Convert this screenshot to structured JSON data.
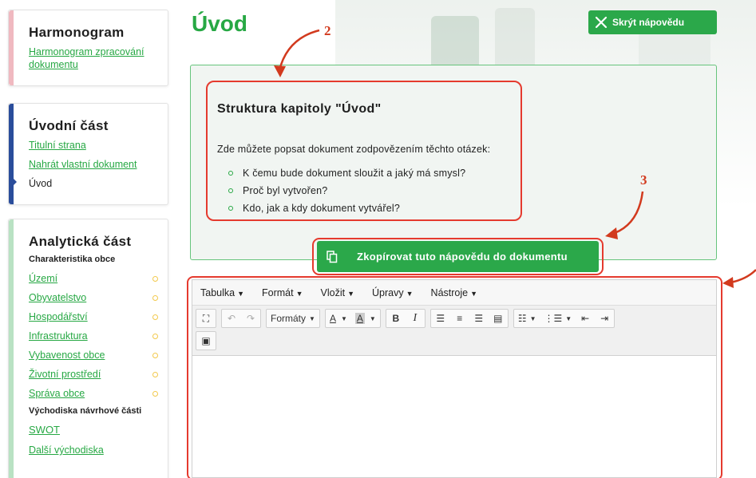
{
  "sidebar": {
    "harmonogram": {
      "title": "Harmonogram",
      "links": [
        "Harmonogram zpracování dokumentu"
      ]
    },
    "uvodni": {
      "title": "Úvodní část",
      "links": [
        "Titulní strana",
        "Nahrát vlastní dokument"
      ],
      "current": "Úvod"
    },
    "analyticka": {
      "title": "Analytická část",
      "section1": "Charakteristika obce",
      "items": [
        "Území",
        "Obyvatelstvo",
        "Hospodářství",
        "Infrastruktura",
        "Vybavenost obce",
        "Životní prostředí",
        "Správa obce"
      ],
      "section2": "Východiska návrhové části",
      "items2": [
        "SWOT",
        "Další východiska"
      ]
    }
  },
  "main": {
    "title": "Úvod",
    "hide_help": "Skrýt nápovědu",
    "help": {
      "title": "Struktura kapitoly \"Úvod\"",
      "intro": "Zde můžete popsat dokument zodpovězením těchto otázek:",
      "questions": [
        "K čemu bude dokument sloužit a jaký má smysl?",
        "Proč byl vytvořen?",
        "Kdo, jak a kdy dokument vytvářel?"
      ]
    },
    "copy_button": "Zkopírovat tuto nápovědu do dokumentu"
  },
  "editor": {
    "menu": [
      "Tabulka",
      "Formát",
      "Vložit",
      "Úpravy",
      "Nástroje"
    ],
    "formats_label": "Formáty",
    "bold": "B",
    "italic": "I",
    "font_color": "A",
    "bg_color": "A"
  },
  "annotations": {
    "n2": "2",
    "n3": "3"
  },
  "colors": {
    "accent": "#27a844",
    "annotation": "#e53a2e"
  }
}
